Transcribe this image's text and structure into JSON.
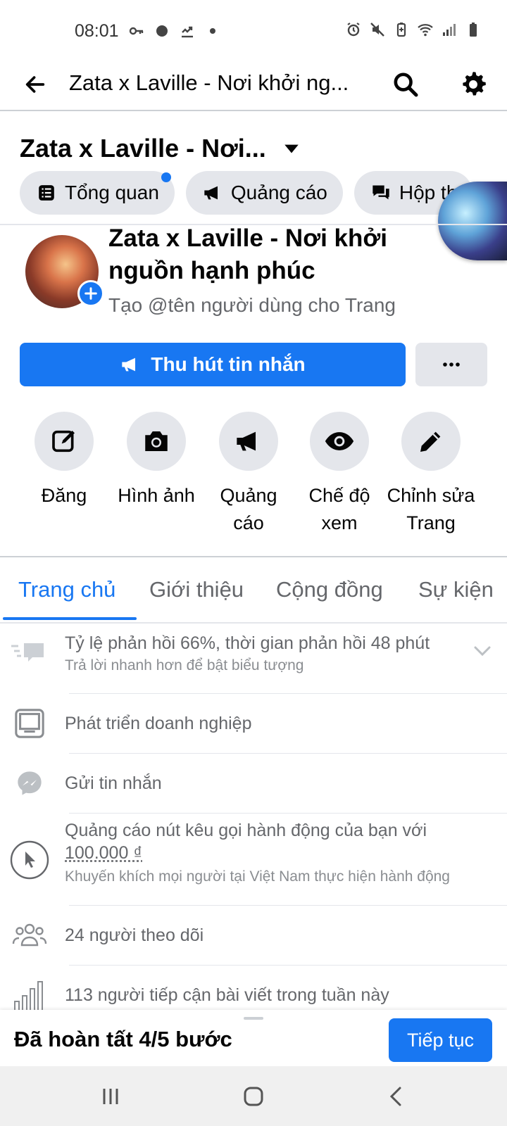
{
  "status_bar": {
    "time": "08:01",
    "left_icons": [
      "key-icon",
      "circle-icon",
      "sync-icon",
      "dot-icon"
    ],
    "right_icons": [
      "alarm-icon",
      "mute-icon",
      "battery-saver-icon",
      "wifi-icon",
      "signal-icon",
      "battery-icon"
    ]
  },
  "app_bar": {
    "title": "Zata x Laville - Nơi khởi ng..."
  },
  "page_header": {
    "name": "Zata x Laville - Nơi...",
    "chips": [
      {
        "label": "Tổng quan",
        "icon": "list-icon",
        "has_dot": true
      },
      {
        "label": "Quảng cáo",
        "icon": "megaphone-icon",
        "has_dot": false
      },
      {
        "label": "Hộp th",
        "icon": "chat-icon",
        "has_dot": false
      }
    ]
  },
  "profile": {
    "name": "Zata x Laville - Nơi khởi nguồn hạnh phúc",
    "username_prompt": "Tạo @tên người dùng cho Trang",
    "primary_button": "Thu hút tin nhắn",
    "more_button": "···"
  },
  "actions": [
    {
      "label": "Đăng",
      "icon": "compose-icon"
    },
    {
      "label": "Hình ảnh",
      "icon": "camera-icon"
    },
    {
      "label": "Quảng cáo",
      "icon": "megaphone-icon"
    },
    {
      "label": "Chế độ xem",
      "icon": "eye-icon"
    },
    {
      "label": "Chỉnh sửa Trang",
      "icon": "pencil-icon"
    }
  ],
  "tabs": [
    {
      "label": "Trang chủ",
      "active": true
    },
    {
      "label": "Giới thiệu",
      "active": false
    },
    {
      "label": "Cộng đồng",
      "active": false
    },
    {
      "label": "Sự kiện",
      "active": false
    }
  ],
  "info_items": [
    {
      "title": "Tỷ lệ phản hồi 66%, thời gian phản hồi 48 phút",
      "subtitle": "Trả lời nhanh hơn để bật biểu tượng",
      "icon": "response-icon"
    },
    {
      "title": "Phát triển doanh nghiệp",
      "subtitle": "",
      "icon": "laptop-icon"
    },
    {
      "title": "Gửi tin nhắn",
      "subtitle": "",
      "icon": "messenger-icon"
    },
    {
      "title": "Quảng cáo nút kêu gọi hành động của bạn với",
      "title2": "100.000 ₫",
      "subtitle": "Khuyến khích mọi người tại Việt Nam thực hiện hành động",
      "icon": "cursor-icon"
    },
    {
      "title": "24 người theo dõi",
      "subtitle": "",
      "icon": "people-icon"
    },
    {
      "title": "113 người tiếp cận bài viết trong tuần này",
      "subtitle": "",
      "icon": "bar-chart-icon"
    }
  ],
  "progress": {
    "text": "Đã hoàn tất 4/5 bước",
    "continue_label": "Tiếp tục"
  },
  "colors": {
    "accent": "#1877f2",
    "chip_bg": "#e4e6eb",
    "secondary_text": "#65676b"
  }
}
